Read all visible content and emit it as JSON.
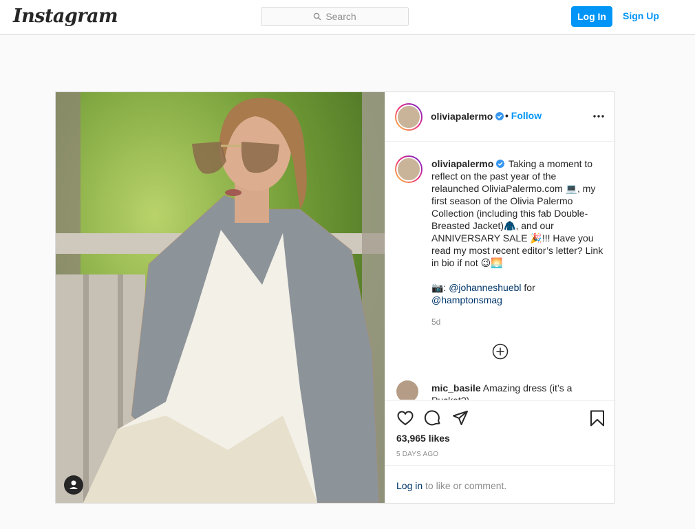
{
  "nav": {
    "logo": "Instagram",
    "search_placeholder": "Search",
    "login_label": "Log In",
    "signup_label": "Sign Up"
  },
  "post": {
    "username": "oliviapalermo",
    "follow_label": "Follow",
    "follow_dot": "•",
    "caption": {
      "text_part1": " Taking a moment to reflect on the past year of the relaunched OliviaPalermo.com 💻, my first season of the Olivia Palermo Collection (including this fab Double-Breasted Jacket)🧥, and our ANNIVERSARY SALE 🎉!!! Have you read my most recent editor’s letter? Link in bio if not 😉🌅\n\n📷: ",
      "mention_photographer": "@johanneshuebl",
      "for_text": " for ",
      "mention_mag": "@hamptonsmag"
    },
    "age": "5d",
    "comment": {
      "username": "mic_basile",
      "text": "Amazing dress (it’s a Pucket?)"
    },
    "likes": "63,965 likes",
    "date": "5 DAYS AGO",
    "login_prompt": {
      "link": "Log in",
      "rest": " to like or comment."
    }
  },
  "icons": {
    "search": "search-icon",
    "verified": "verified-badge-icon",
    "more": "more-options-icon",
    "load_more": "add-circle-icon",
    "like": "heart-icon",
    "comment": "comment-icon",
    "share": "share-icon",
    "save": "bookmark-icon",
    "user_tag": "user-tag-icon"
  },
  "colors": {
    "accent": "#0095f6",
    "link": "#00376b",
    "muted": "#8e8e8e",
    "border": "#dbdbdb"
  }
}
